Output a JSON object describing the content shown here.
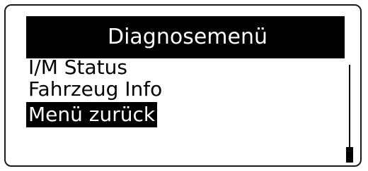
{
  "title": "Diagnosemenü",
  "menu": {
    "items": [
      {
        "label": "I/M Status",
        "selected": false
      },
      {
        "label": "Fahrzeug Info",
        "selected": false
      },
      {
        "label": "Menü zurück",
        "selected": true
      }
    ]
  },
  "scrollbar": {
    "position_fraction": 1.0
  },
  "colors": {
    "background": "#ffffff",
    "foreground": "#000000",
    "highlight": "#000000"
  }
}
